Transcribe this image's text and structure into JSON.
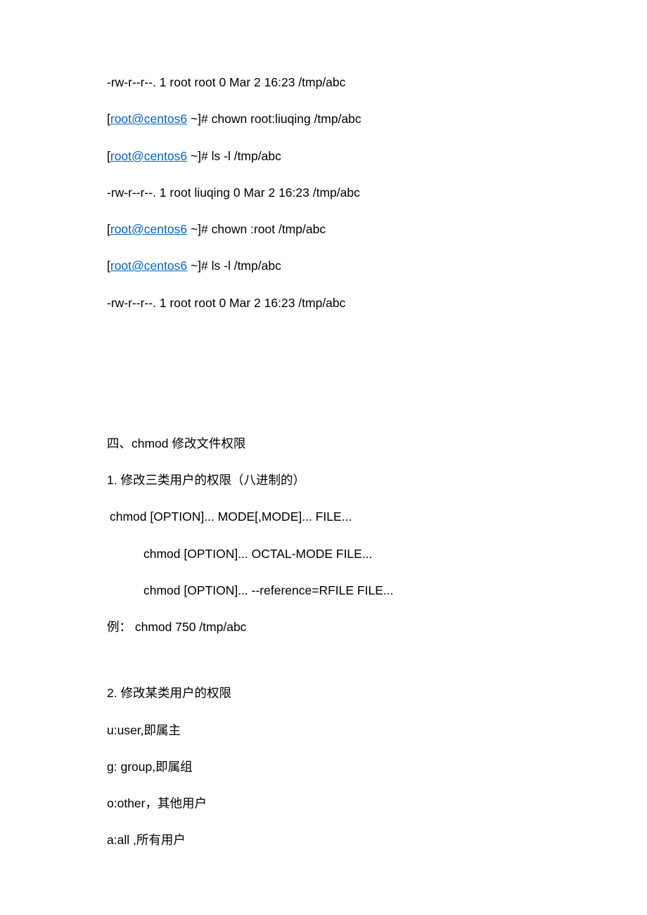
{
  "lines": {
    "l1": "-rw-r--r--. 1 root root 0 Mar  2 16:23 /tmp/abc",
    "l2a": "[",
    "l2link": "root@centos6",
    "l2b": " ~]# chown root:liuqing /tmp/abc",
    "l3a": "[",
    "l3link": "root@centos6",
    "l3b": " ~]# ls -l /tmp/abc",
    "l4": "-rw-r--r--. 1 root liuqing 0 Mar  2 16:23 /tmp/abc",
    "l5a": "[",
    "l5link": "root@centos6",
    "l5b": " ~]# chown :root /tmp/abc",
    "l6a": "[",
    "l6link": "root@centos6",
    "l6b": " ~]# ls -l /tmp/abc",
    "l7": "-rw-r--r--. 1 root root 0 Mar  2 16:23 /tmp/abc",
    "h1": "四、chmod 修改文件权限",
    "s1": "1.  修改三类用户的权限（八进制的）",
    "s2": " chmod [OPTION]... MODE[,MODE]... FILE...",
    "s3": "chmod [OPTION]... OCTAL-MODE FILE...",
    "s4": "chmod [OPTION]... --reference=RFILE FILE...",
    "s5": "例：   chmod 750 /tmp/abc",
    "t1": "2.  修改某类用户的权限",
    "t2": "u:user,即属主",
    "t3": "g: group,即属组",
    "t4": "o:other，其他用户",
    "t5": "a:all ,所有用户"
  }
}
